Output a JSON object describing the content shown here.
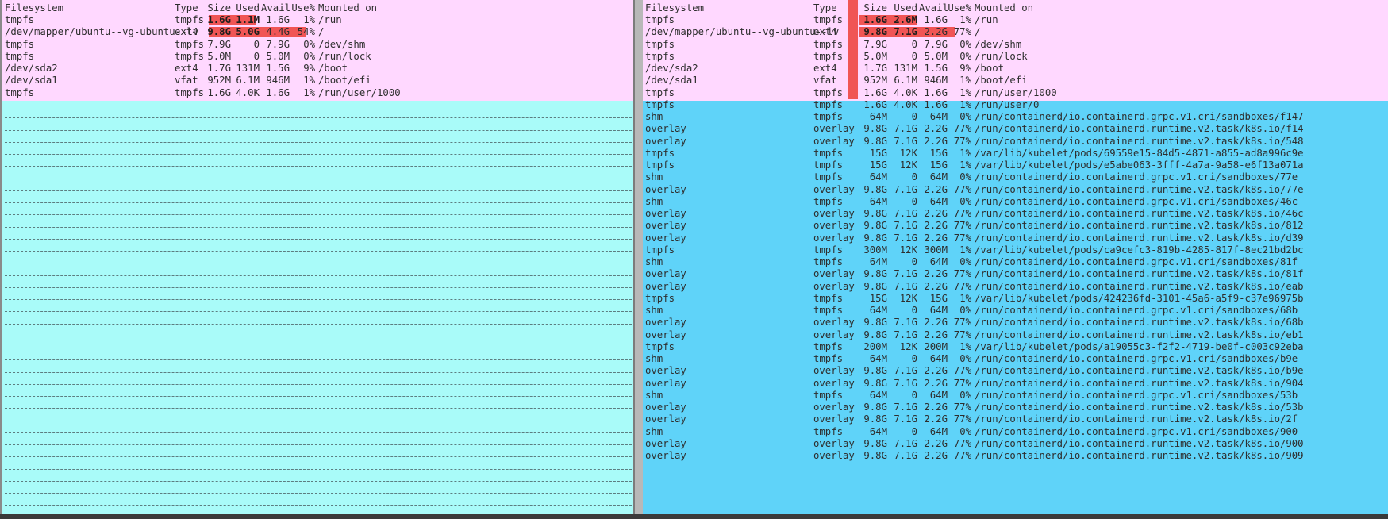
{
  "colors": {
    "highlight_row_bg": "#ffd8ff",
    "left_empty_bg": "#a9fbf9",
    "right_list_bg": "#5fd3f9",
    "usage_bar": "#f05555"
  },
  "left": {
    "headers": {
      "filesystem": "Filesystem",
      "type": "Type",
      "size": "Size",
      "used": "Used",
      "avail": "Avail",
      "pct": "Use%",
      "mount": "Mounted on"
    },
    "rows": [
      {
        "fs": "tmpfs",
        "type": "tmpfs",
        "size": "1.6G",
        "used": "1.1M",
        "avail": "1.6G",
        "pct": "1%",
        "mount": "/run",
        "usage": 0.01
      },
      {
        "fs": "/dev/mapper/ubuntu--vg-ubuntu--lv",
        "type": "ext4",
        "size": "9.8G",
        "used": "5.0G",
        "avail": "4.4G",
        "pct": "54%",
        "mount": "/",
        "usage": 0.54
      },
      {
        "fs": "tmpfs",
        "type": "tmpfs",
        "size": "7.9G",
        "used": "0",
        "avail": "7.9G",
        "pct": "0%",
        "mount": "/dev/shm"
      },
      {
        "fs": "tmpfs",
        "type": "tmpfs",
        "size": "5.0M",
        "used": "0",
        "avail": "5.0M",
        "pct": "0%",
        "mount": "/run/lock"
      },
      {
        "fs": "/dev/sda2",
        "type": "ext4",
        "size": "1.7G",
        "used": "131M",
        "avail": "1.5G",
        "pct": "9%",
        "mount": "/boot"
      },
      {
        "fs": "/dev/sda1",
        "type": "vfat",
        "size": "952M",
        "used": "6.1M",
        "avail": "946M",
        "pct": "1%",
        "mount": "/boot/efi"
      },
      {
        "fs": "tmpfs",
        "type": "tmpfs",
        "size": "1.6G",
        "used": "4.0K",
        "avail": "1.6G",
        "pct": "1%",
        "mount": "/run/user/1000"
      }
    ]
  },
  "right": {
    "headers": {
      "filesystem": "Filesystem",
      "type": "Type",
      "size": "Size",
      "used": "Used",
      "avail": "Avail",
      "pct": "Use%",
      "mount": "Mounted on"
    },
    "rows": [
      {
        "fs": "tmpfs",
        "type": "tmpfs",
        "size": "1.6G",
        "used": "2.6M",
        "avail": "1.6G",
        "pct": "1%",
        "mount": "/run",
        "usage": 0.01,
        "hl": true
      },
      {
        "fs": "/dev/mapper/ubuntu--vg-ubuntu--lv",
        "type": "ext4",
        "size": "9.8G",
        "used": "7.1G",
        "avail": "2.2G",
        "pct": "77%",
        "mount": "/",
        "usage": 0.77,
        "hl": true
      },
      {
        "fs": "tmpfs",
        "type": "tmpfs",
        "size": "7.9G",
        "used": "0",
        "avail": "7.9G",
        "pct": "0%",
        "mount": "/dev/shm",
        "hl": true
      },
      {
        "fs": "tmpfs",
        "type": "tmpfs",
        "size": "5.0M",
        "used": "0",
        "avail": "5.0M",
        "pct": "0%",
        "mount": "/run/lock",
        "hl": true
      },
      {
        "fs": "/dev/sda2",
        "type": "ext4",
        "size": "1.7G",
        "used": "131M",
        "avail": "1.5G",
        "pct": "9%",
        "mount": "/boot",
        "hl": true
      },
      {
        "fs": "/dev/sda1",
        "type": "vfat",
        "size": "952M",
        "used": "6.1M",
        "avail": "946M",
        "pct": "1%",
        "mount": "/boot/efi",
        "hl": true
      },
      {
        "fs": "tmpfs",
        "type": "tmpfs",
        "size": "1.6G",
        "used": "4.0K",
        "avail": "1.6G",
        "pct": "1%",
        "mount": "/run/user/1000",
        "hl": true
      },
      {
        "fs": "tmpfs",
        "type": "tmpfs",
        "size": "1.6G",
        "used": "4.0K",
        "avail": "1.6G",
        "pct": "1%",
        "mount": "/run/user/0"
      },
      {
        "fs": "shm",
        "type": "tmpfs",
        "size": "64M",
        "used": "0",
        "avail": "64M",
        "pct": "0%",
        "mount": "/run/containerd/io.containerd.grpc.v1.cri/sandboxes/f147"
      },
      {
        "fs": "overlay",
        "type": "overlay",
        "size": "9.8G",
        "used": "7.1G",
        "avail": "2.2G",
        "pct": "77%",
        "mount": "/run/containerd/io.containerd.runtime.v2.task/k8s.io/f14"
      },
      {
        "fs": "overlay",
        "type": "overlay",
        "size": "9.8G",
        "used": "7.1G",
        "avail": "2.2G",
        "pct": "77%",
        "mount": "/run/containerd/io.containerd.runtime.v2.task/k8s.io/548"
      },
      {
        "fs": "tmpfs",
        "type": "tmpfs",
        "size": "15G",
        "used": "12K",
        "avail": "15G",
        "pct": "1%",
        "mount": "/var/lib/kubelet/pods/69559e15-84d5-4871-a855-ad8a996c9e"
      },
      {
        "fs": "tmpfs",
        "type": "tmpfs",
        "size": "15G",
        "used": "12K",
        "avail": "15G",
        "pct": "1%",
        "mount": "/var/lib/kubelet/pods/e5abe063-3fff-4a7a-9a58-e6f13a071a"
      },
      {
        "fs": "shm",
        "type": "tmpfs",
        "size": "64M",
        "used": "0",
        "avail": "64M",
        "pct": "0%",
        "mount": "/run/containerd/io.containerd.grpc.v1.cri/sandboxes/77e"
      },
      {
        "fs": "overlay",
        "type": "overlay",
        "size": "9.8G",
        "used": "7.1G",
        "avail": "2.2G",
        "pct": "77%",
        "mount": "/run/containerd/io.containerd.runtime.v2.task/k8s.io/77e"
      },
      {
        "fs": "shm",
        "type": "tmpfs",
        "size": "64M",
        "used": "0",
        "avail": "64M",
        "pct": "0%",
        "mount": "/run/containerd/io.containerd.grpc.v1.cri/sandboxes/46c"
      },
      {
        "fs": "overlay",
        "type": "overlay",
        "size": "9.8G",
        "used": "7.1G",
        "avail": "2.2G",
        "pct": "77%",
        "mount": "/run/containerd/io.containerd.runtime.v2.task/k8s.io/46c"
      },
      {
        "fs": "overlay",
        "type": "overlay",
        "size": "9.8G",
        "used": "7.1G",
        "avail": "2.2G",
        "pct": "77%",
        "mount": "/run/containerd/io.containerd.runtime.v2.task/k8s.io/812"
      },
      {
        "fs": "overlay",
        "type": "overlay",
        "size": "9.8G",
        "used": "7.1G",
        "avail": "2.2G",
        "pct": "77%",
        "mount": "/run/containerd/io.containerd.runtime.v2.task/k8s.io/d39"
      },
      {
        "fs": "tmpfs",
        "type": "tmpfs",
        "size": "300M",
        "used": "12K",
        "avail": "300M",
        "pct": "1%",
        "mount": "/var/lib/kubelet/pods/ca9cefc3-819b-4285-817f-8ec21bd2bc"
      },
      {
        "fs": "shm",
        "type": "tmpfs",
        "size": "64M",
        "used": "0",
        "avail": "64M",
        "pct": "0%",
        "mount": "/run/containerd/io.containerd.grpc.v1.cri/sandboxes/81f"
      },
      {
        "fs": "overlay",
        "type": "overlay",
        "size": "9.8G",
        "used": "7.1G",
        "avail": "2.2G",
        "pct": "77%",
        "mount": "/run/containerd/io.containerd.runtime.v2.task/k8s.io/81f"
      },
      {
        "fs": "overlay",
        "type": "overlay",
        "size": "9.8G",
        "used": "7.1G",
        "avail": "2.2G",
        "pct": "77%",
        "mount": "/run/containerd/io.containerd.runtime.v2.task/k8s.io/eab"
      },
      {
        "fs": "tmpfs",
        "type": "tmpfs",
        "size": "15G",
        "used": "12K",
        "avail": "15G",
        "pct": "1%",
        "mount": "/var/lib/kubelet/pods/424236fd-3101-45a6-a5f9-c37e96975b"
      },
      {
        "fs": "shm",
        "type": "tmpfs",
        "size": "64M",
        "used": "0",
        "avail": "64M",
        "pct": "0%",
        "mount": "/run/containerd/io.containerd.grpc.v1.cri/sandboxes/68b"
      },
      {
        "fs": "overlay",
        "type": "overlay",
        "size": "9.8G",
        "used": "7.1G",
        "avail": "2.2G",
        "pct": "77%",
        "mount": "/run/containerd/io.containerd.runtime.v2.task/k8s.io/68b"
      },
      {
        "fs": "overlay",
        "type": "overlay",
        "size": "9.8G",
        "used": "7.1G",
        "avail": "2.2G",
        "pct": "77%",
        "mount": "/run/containerd/io.containerd.runtime.v2.task/k8s.io/eb1"
      },
      {
        "fs": "tmpfs",
        "type": "tmpfs",
        "size": "200M",
        "used": "12K",
        "avail": "200M",
        "pct": "1%",
        "mount": "/var/lib/kubelet/pods/a19055c3-f2f2-4719-be0f-c003c92eba"
      },
      {
        "fs": "shm",
        "type": "tmpfs",
        "size": "64M",
        "used": "0",
        "avail": "64M",
        "pct": "0%",
        "mount": "/run/containerd/io.containerd.grpc.v1.cri/sandboxes/b9e"
      },
      {
        "fs": "overlay",
        "type": "overlay",
        "size": "9.8G",
        "used": "7.1G",
        "avail": "2.2G",
        "pct": "77%",
        "mount": "/run/containerd/io.containerd.runtime.v2.task/k8s.io/b9e"
      },
      {
        "fs": "overlay",
        "type": "overlay",
        "size": "9.8G",
        "used": "7.1G",
        "avail": "2.2G",
        "pct": "77%",
        "mount": "/run/containerd/io.containerd.runtime.v2.task/k8s.io/904"
      },
      {
        "fs": "shm",
        "type": "tmpfs",
        "size": "64M",
        "used": "0",
        "avail": "64M",
        "pct": "0%",
        "mount": "/run/containerd/io.containerd.grpc.v1.cri/sandboxes/53b"
      },
      {
        "fs": "overlay",
        "type": "overlay",
        "size": "9.8G",
        "used": "7.1G",
        "avail": "2.2G",
        "pct": "77%",
        "mount": "/run/containerd/io.containerd.runtime.v2.task/k8s.io/53b"
      },
      {
        "fs": "overlay",
        "type": "overlay",
        "size": "9.8G",
        "used": "7.1G",
        "avail": "2.2G",
        "pct": "77%",
        "mount": "/run/containerd/io.containerd.runtime.v2.task/k8s.io/2f"
      },
      {
        "fs": "shm",
        "type": "tmpfs",
        "size": "64M",
        "used": "0",
        "avail": "64M",
        "pct": "0%",
        "mount": "/run/containerd/io.containerd.grpc.v1.cri/sandboxes/900"
      },
      {
        "fs": "overlay",
        "type": "overlay",
        "size": "9.8G",
        "used": "7.1G",
        "avail": "2.2G",
        "pct": "77%",
        "mount": "/run/containerd/io.containerd.runtime.v2.task/k8s.io/900"
      },
      {
        "fs": "overlay",
        "type": "overlay",
        "size": "9.8G",
        "used": "7.1G",
        "avail": "2.2G",
        "pct": "77%",
        "mount": "/run/containerd/io.containerd.runtime.v2.task/k8s.io/909"
      }
    ]
  }
}
